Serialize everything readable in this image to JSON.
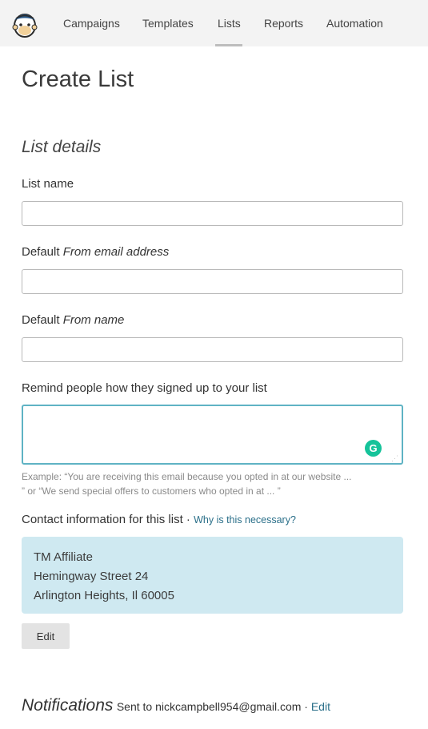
{
  "nav": {
    "items": [
      {
        "label": "Campaigns"
      },
      {
        "label": "Templates"
      },
      {
        "label": "Lists"
      },
      {
        "label": "Reports"
      },
      {
        "label": "Automation"
      }
    ],
    "active": "Lists"
  },
  "page": {
    "title": "Create List",
    "section_title": "List details"
  },
  "form": {
    "list_name_label": "List name",
    "list_name_value": "",
    "from_email_label_prefix": "Default",
    "from_email_label_em": "From email address",
    "from_email_value": "",
    "from_name_label_prefix": "Default",
    "from_name_label_em": "From name",
    "from_name_value": "",
    "reminder_label": "Remind people how they signed up to your list",
    "reminder_value": "",
    "reminder_help_1": "Example: “You are receiving this email because you opted in at our website ...",
    "reminder_help_2": "” or “We send special offers to customers who opted in at ... ”"
  },
  "contact": {
    "label": "Contact information for this list",
    "separator": " · ",
    "why_link": "Why is this necessary?",
    "lines": [
      "TM Affiliate",
      "Hemingway Street 24",
      "Arlington Heights, Il 60005"
    ],
    "edit_label": "Edit",
    "box_color": "#cfe9f1"
  },
  "notifications": {
    "title": "Notifications",
    "text": "Sent to nickcampbell954@gmail.com",
    "separator": " · ",
    "edit_label": "Edit"
  },
  "icons": {
    "logo": "mailchimp-logo",
    "grammarly": "grammarly-icon",
    "grip": "resize-grip-icon"
  },
  "colors": {
    "link": "#2a6f89",
    "textarea_focus": "#5fb3c4",
    "grammarly": "#15c39a"
  }
}
